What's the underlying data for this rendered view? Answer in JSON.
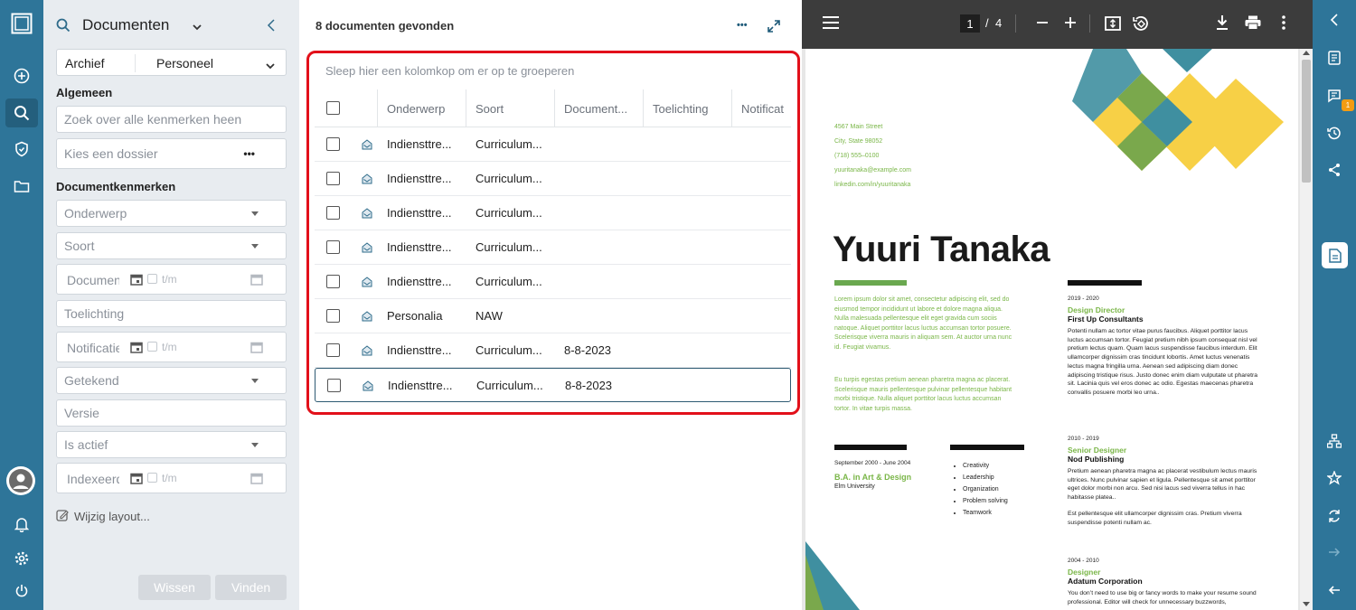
{
  "filter_panel": {
    "title": "Documenten",
    "archive_label": "Archief",
    "archive_value": "Personeel",
    "section_general": "Algemeen",
    "search_placeholder": "Zoek over alle kenmerken heen",
    "dossier_placeholder": "Kies een dossier",
    "section_doc": "Documentkenmerken",
    "fields": {
      "onderwerp": "Onderwerp",
      "soort": "Soort",
      "docdate": "Documentdatum",
      "toelichting": "Toelichting",
      "notificatie": "Notificatiedatum",
      "getekend": "Getekend",
      "versie": "Versie",
      "isactief": "Is actief",
      "indexeer": "Indexeerdatum",
      "tm": "t/m"
    },
    "change_layout": "Wijzig layout...",
    "clear_button": "Wissen",
    "find_button": "Vinden"
  },
  "results": {
    "count_text": "8 documenten gevonden",
    "group_hint": "Sleep hier een kolomkop om er op te groeperen",
    "columns": [
      "Onderwerp",
      "Soort",
      "Document...",
      "Toelichting",
      "Notificat"
    ],
    "rows": [
      {
        "onderwerp": "Indiensttre...",
        "soort": "Curriculum...",
        "datum": ""
      },
      {
        "onderwerp": "Indiensttre...",
        "soort": "Curriculum...",
        "datum": ""
      },
      {
        "onderwerp": "Indiensttre...",
        "soort": "Curriculum...",
        "datum": ""
      },
      {
        "onderwerp": "Indiensttre...",
        "soort": "Curriculum...",
        "datum": ""
      },
      {
        "onderwerp": "Indiensttre...",
        "soort": "Curriculum...",
        "datum": ""
      },
      {
        "onderwerp": "Personalia",
        "soort": "NAW",
        "datum": ""
      },
      {
        "onderwerp": "Indiensttre...",
        "soort": "Curriculum...",
        "datum": "8-8-2023"
      },
      {
        "onderwerp": "Indiensttre...",
        "soort": "Curriculum...",
        "datum": "8-8-2023"
      }
    ]
  },
  "viewer": {
    "page_current": "1",
    "page_sep": "/",
    "page_total": "4",
    "resume": {
      "address": "4567 Main Street",
      "city": "City, State 98052",
      "phone": "(718) 555–0100",
      "email": "yuuritanaka@example.com",
      "linkedin": "linkedin.com/in/yuuritanaka",
      "name": "Yuuri Tanaka",
      "intro1": "Lorem ipsum dolor sit amet, consectetur adipiscing elit, sed do eiusmod tempor incididunt ut labore et dolore magna aliqua. Nulla malesuada pellentesque elit eget gravida cum sociis natoque. Aliquet porttitor lacus luctus accumsan tortor posuere. Scelerisque viverra mauris in aliquam sem. At auctor urna nunc id. Feugiat vivamus.",
      "intro2": "Eu turpis egestas pretium aenean pharetra magna ac placerat. Scelerisque mauris pellentesque pulvinar pellentesque habitant morbi tristique. Nulla aliquet porttitor lacus luctus accumsan tortor. In vitae turpis massa.",
      "edu_dates": "September 2000 - June 2004",
      "edu_degree": "B.A. in Art & Design",
      "edu_school": "Elm University",
      "skills": [
        "Creativity",
        "Leadership",
        "Organization",
        "Problem solving",
        "Teamwork"
      ],
      "jobs": [
        {
          "dates": "2019 - 2020",
          "title": "Design Director",
          "company": "First Up Consultants",
          "desc": "Potenti nullam ac tortor vitae purus faucibus. Aliquet porttitor lacus luctus accumsan tortor. Feugiat pretium nibh ipsum consequat nisl vel pretium lectus quam. Quam lacus suspendisse faucibus interdum. Elit ullamcorper dignissim cras tincidunt lobortis. Amet luctus venenatis lectus magna fringilla urna. Aenean sed adipiscing diam donec adipiscing tristique risus. Justo donec enim diam vulputate ut pharetra sit. Lacinia quis vel eros donec ac odio. Egestas maecenas pharetra convallis posuere morbi leo urna..",
          "desc2": ""
        },
        {
          "dates": "2010 - 2019",
          "title": "Senior Designer",
          "company": "Nod Publishing",
          "desc": "Pretium aenean pharetra magna ac placerat vestibulum lectus mauris ultrices. Nunc pulvinar sapien et ligula. Pellentesque sit amet porttitor eget dolor morbi non arcu. Sed nisi lacus sed viverra tellus in hac habitasse platea..",
          "desc2": "Est pellentesque elit ullamcorper dignissim cras. Pretium viverra suspendisse potenti nullam ac."
        },
        {
          "dates": "2004 - 2010",
          "title": "Designer",
          "company": "Adatum Corporation",
          "desc": "You don’t need to use big or fancy words to make your resume sound professional. Editor will check for unnecessary buzzwords,",
          "desc2": ""
        }
      ]
    }
  },
  "notification_count": "1",
  "colors": {
    "sidebar": "#2e7599",
    "accent_red": "#e2101a",
    "resume_green": "#7ab648",
    "resume_yellow": "#f7d046",
    "resume_teal": "#3f8fa0"
  }
}
